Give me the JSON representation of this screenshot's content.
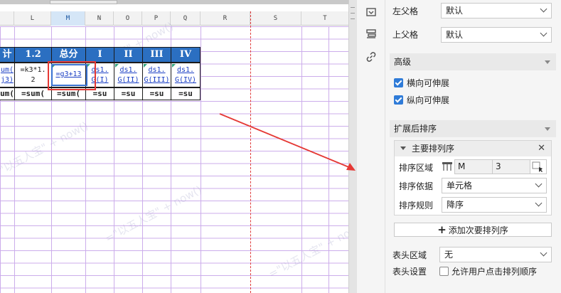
{
  "sheet": {
    "columns": [
      {
        "id": "K",
        "label": ""
      },
      {
        "id": "L",
        "label": "L"
      },
      {
        "id": "M",
        "label": "M"
      },
      {
        "id": "N",
        "label": "N"
      },
      {
        "id": "O",
        "label": "O"
      },
      {
        "id": "P",
        "label": "P"
      },
      {
        "id": "Q",
        "label": "Q"
      },
      {
        "id": "R",
        "label": "R"
      },
      {
        "id": "S",
        "label": "S"
      },
      {
        "id": "T",
        "label": "T"
      }
    ],
    "active_column": "M",
    "header_row": [
      "计",
      "1.2",
      "总分",
      "I",
      "II",
      "III",
      "IV"
    ],
    "formula_row": [
      {
        "l1": "um(",
        "l2": "j3)",
        "link": false
      },
      {
        "l1": "=k3*1.",
        "l2": "2",
        "link": false
      },
      {
        "l1": "=g3+13",
        "l2": "",
        "link": true
      },
      {
        "l1": "ds1.",
        "l2": "G(I)",
        "link": true
      },
      {
        "l1": "ds1.",
        "l2": "G(II)",
        "link": true
      },
      {
        "l1": "ds1.",
        "l2": "G(III)",
        "link": true
      },
      {
        "l1": "ds1.",
        "l2": "G(IV)",
        "link": true
      }
    ],
    "sum_row": [
      "um(",
      "=sum(",
      "=sum(",
      "=su",
      "=su",
      "=su",
      "=su"
    ],
    "watermark_text": "=\"以五人宝\" + now()",
    "colors": {
      "header_bg": "#2b6fc1",
      "grid_line": "#ccadeb",
      "dash_line": "#e03a3a",
      "highlight": "#e53935",
      "link": "#1b3fc4"
    }
  },
  "toolbar_strip": {
    "icons": [
      "cell-element-icon",
      "cell-attribute-icon",
      "hyperlink-icon"
    ]
  },
  "panel": {
    "left_parent_label": "左父格",
    "left_parent_value": "默认",
    "top_parent_label": "上父格",
    "top_parent_value": "默认",
    "advanced_title": "高级",
    "horizontal_expand": "横向可伸展",
    "vertical_expand": "纵向可伸展",
    "horizontal_checked": true,
    "vertical_checked": true,
    "sort_title": "扩展后排序",
    "primary_sort": {
      "title": "主要排列序",
      "close_symbol": "✕",
      "area_label": "排序区域",
      "area_col": "M",
      "area_row": "3",
      "basis_label": "排序依据",
      "basis_value": "单元格",
      "rule_label": "排序规则",
      "rule_value": "降序"
    },
    "add_secondary": "添加次要排列序",
    "add_symbol": "+",
    "header_area_label": "表头区域",
    "header_area_value": "无",
    "header_settings_label": "表头设置",
    "allow_click_sort": "允许用户点击排列顺序",
    "allow_click_checked": false,
    "accent": "#2f7bd8"
  }
}
